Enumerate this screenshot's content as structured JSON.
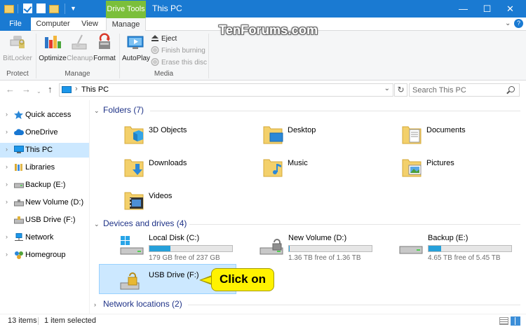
{
  "window": {
    "title": "This PC",
    "context_tab": "Drive Tools",
    "controls": {
      "minimize": "—",
      "maximize": "☐",
      "close": "✕"
    }
  },
  "ribbon": {
    "tabs": {
      "file": "File",
      "computer": "Computer",
      "view": "View",
      "manage": "Manage"
    },
    "groups": {
      "protect": {
        "label": "Protect",
        "bitlocker": "BitLocker"
      },
      "manage": {
        "label": "Manage",
        "optimize": "Optimize",
        "cleanup": "Cleanup",
        "format": "Format"
      },
      "media": {
        "label": "Media",
        "autoplay": "AutoPlay",
        "eject": "Eject",
        "finish_burning": "Finish burning",
        "erase_disc": "Erase this disc"
      }
    }
  },
  "watermark": "TenForums.com",
  "address": {
    "path": "This PC",
    "search_placeholder": "Search This PC"
  },
  "nav": {
    "items": [
      {
        "label": "Quick access"
      },
      {
        "label": "OneDrive"
      },
      {
        "label": "This PC"
      },
      {
        "label": "Libraries"
      },
      {
        "label": "Backup (E:)"
      },
      {
        "label": "New Volume (D:)"
      },
      {
        "label": "USB Drive (F:)"
      },
      {
        "label": "Network"
      },
      {
        "label": "Homegroup"
      }
    ]
  },
  "groups": {
    "folders": {
      "header": "Folders (7)",
      "items": [
        "3D Objects",
        "Desktop",
        "Documents",
        "Downloads",
        "Music",
        "Pictures",
        "Videos"
      ]
    },
    "devices": {
      "header": "Devices and drives (4)",
      "drives": [
        {
          "name": "Local Disk (C:)",
          "free": "179 GB free of 237 GB",
          "used_fraction": 0.25
        },
        {
          "name": "New Volume (D:)",
          "free": "1.36 TB free of 1.36 TB",
          "used_fraction": 0.01
        },
        {
          "name": "Backup (E:)",
          "free": "4.65 TB free of 5.45 TB",
          "used_fraction": 0.15
        },
        {
          "name": "USB Drive (F:)"
        }
      ]
    },
    "network": {
      "header": "Network locations (2)"
    }
  },
  "callout": "Click on",
  "status": {
    "count": "13 items",
    "selected": "1 item selected"
  },
  "colors": {
    "accent": "#1a7ad2",
    "context": "#7bbf3a",
    "selection": "#cce8ff",
    "callout": "#fff200",
    "bar_fill": "#26a0da"
  }
}
